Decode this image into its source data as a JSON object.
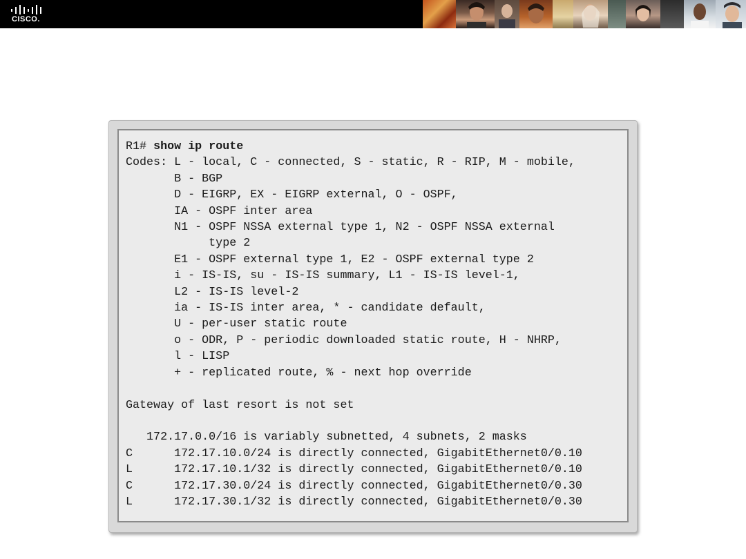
{
  "header": {
    "logo_text": "CISCO."
  },
  "terminal": {
    "prompt": "R1# ",
    "command": "show ip route",
    "lines": [
      "Codes: L - local, C - connected, S - static, R - RIP, M - mobile,",
      "       B - BGP",
      "       D - EIGRP, EX - EIGRP external, O - OSPF,",
      "       IA - OSPF inter area",
      "       N1 - OSPF NSSA external type 1, N2 - OSPF NSSA external",
      "            type 2",
      "       E1 - OSPF external type 1, E2 - OSPF external type 2",
      "       i - IS-IS, su - IS-IS summary, L1 - IS-IS level-1,",
      "       L2 - IS-IS level-2",
      "       ia - IS-IS inter area, * - candidate default,",
      "       U - per-user static route",
      "       o - ODR, P - periodic downloaded static route, H - NHRP,",
      "       l - LISP",
      "       + - replicated route, % - next hop override",
      "",
      "Gateway of last resort is not set",
      "",
      "   172.17.0.0/16 is variably subnetted, 4 subnets, 2 masks",
      "C      172.17.10.0/24 is directly connected, GigabitEthernet0/0.10",
      "L      172.17.10.1/32 is directly connected, GigabitEthernet0/0.10",
      "C      172.17.30.0/24 is directly connected, GigabitEthernet0/0.30",
      "L      172.17.30.1/32 is directly connected, GigabitEthernet0/0.30"
    ]
  },
  "colors": {
    "banner": "#000000",
    "terminal_bg": "#ebebeb",
    "frame_bg": "#d9d9d9",
    "text": "#1a1a1a"
  }
}
